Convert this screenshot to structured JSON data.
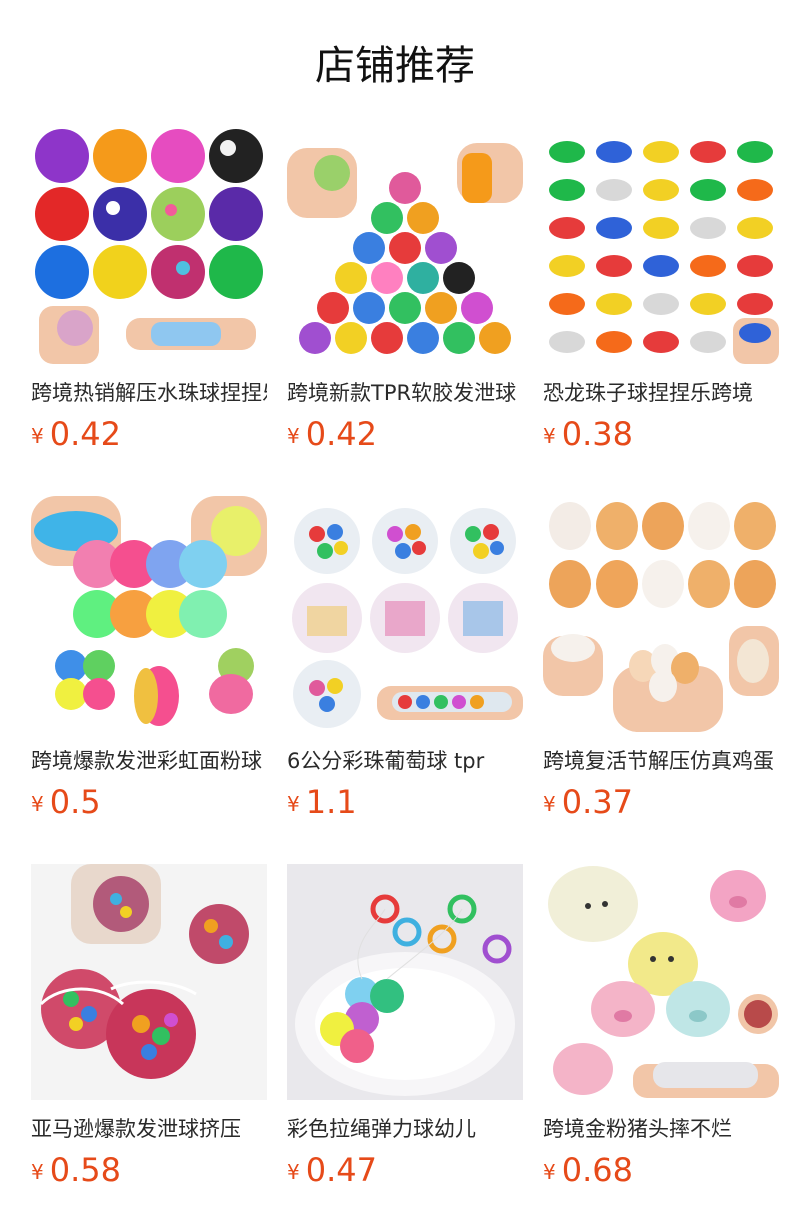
{
  "header": {
    "title": "店铺推荐"
  },
  "currency_symbol": "¥",
  "accent_color": "#e64a19",
  "products": [
    {
      "name": "跨境热销解压水珠球捏捏乐",
      "price": "0.42",
      "image": "orbeez-stress-balls"
    },
    {
      "name": "跨境新款TPR软胶发泄球",
      "price": "0.42",
      "image": "spiky-bead-balls"
    },
    {
      "name": "恐龙珠子球捏捏乐跨境",
      "price": "0.38",
      "image": "dinosaur-bead-squishies"
    },
    {
      "name": "跨境爆款发泄彩虹面粉球",
      "price": "0.5",
      "image": "pastel-flour-balls"
    },
    {
      "name": "6公分彩珠葡萄球 tpr",
      "price": "1.1",
      "image": "rainbow-grape-balls"
    },
    {
      "name": "跨境复活节解压仿真鸡蛋",
      "price": "0.37",
      "image": "squishy-eggs"
    },
    {
      "name": "亚马逊爆款发泄球挤压",
      "price": "0.58",
      "image": "mesh-bead-balls"
    },
    {
      "name": "彩色拉绳弹力球幼儿",
      "price": "0.47",
      "image": "bouncy-balls-string"
    },
    {
      "name": "跨境金粉猪头摔不烂",
      "price": "0.68",
      "image": "glitter-pig-squishies"
    }
  ]
}
